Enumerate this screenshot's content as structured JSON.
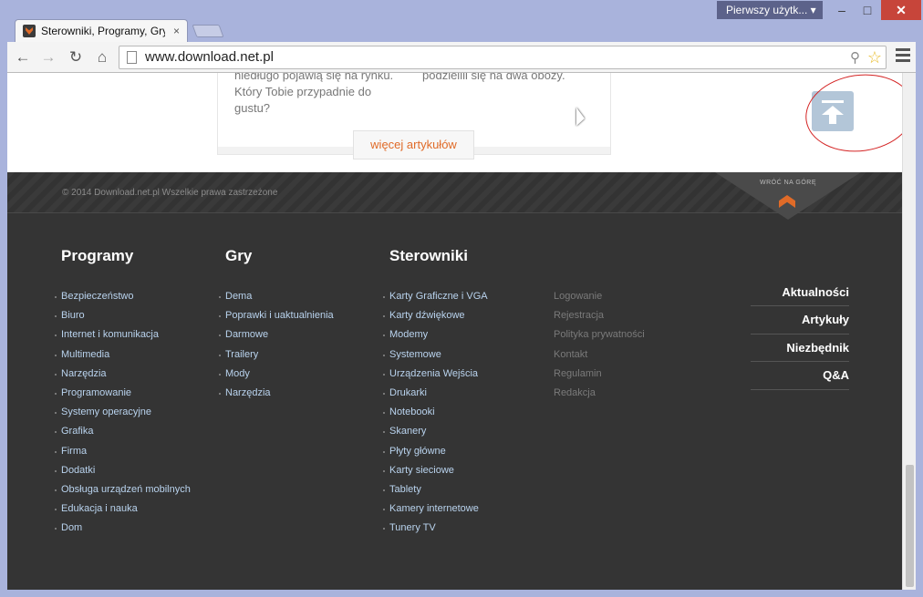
{
  "window": {
    "profile_label": "Pierwszy użytk... ▾",
    "minimize": "–",
    "maximize": "□",
    "close": "✕"
  },
  "tab": {
    "title": "Sterowniki, Programy, Gry",
    "close": "×"
  },
  "toolbar": {
    "url": "www.download.net.pl"
  },
  "article": {
    "left_text": "niedługo pojawią się na rynku. Który Tobie przypadnie do gustu?",
    "right_text": "podzielili się na dwa obozy.",
    "more_button": "więcej artykułów"
  },
  "footer": {
    "copyright": "© 2014 Download.net.pl Wszelkie prawa zastrzeżone",
    "back_to_top": "WRÓĆ NA GÓRĘ",
    "columns": [
      {
        "title": "Programy",
        "items": [
          "Bezpieczeństwo",
          "Biuro",
          "Internet i komunikacja",
          "Multimedia",
          "Narzędzia",
          "Programowanie",
          "Systemy operacyjne",
          "Grafika",
          "Firma",
          "Dodatki",
          "Obsługa urządzeń mobilnych",
          "Edukacja i nauka",
          "Dom"
        ]
      },
      {
        "title": "Gry",
        "items": [
          "Dema",
          "Poprawki i uaktualnienia",
          "Darmowe",
          "Trailery",
          "Mody",
          "Narzędzia"
        ]
      },
      {
        "title": "Sterowniki",
        "items": [
          "Karty Graficzne i VGA",
          "Karty dźwiękowe",
          "Modemy",
          "Systemowe",
          "Urządzenia Wejścia",
          "Drukarki",
          "Notebooki",
          "Skanery",
          "Płyty główne",
          "Karty sieciowe",
          "Tablety",
          "Kamery internetowe",
          "Tunery TV"
        ]
      }
    ],
    "misc_links": [
      "Logowanie",
      "Rejestracja",
      "Polityka prywatności",
      "Kontakt",
      "Regulamin",
      "Redakcja"
    ],
    "right_nav": [
      "Aktualności",
      "Artykuły",
      "Niezbędnik",
      "Q&A"
    ]
  },
  "icons": {
    "back": "back-arrow-icon",
    "forward": "forward-arrow-icon",
    "reload": "reload-icon",
    "home": "home-icon",
    "zoom": "zoom-icon",
    "bookmark": "star-icon",
    "menu": "hamburger-menu-icon",
    "scroll_top": "scroll-to-top-icon"
  },
  "colors": {
    "accent": "#e06b28",
    "footer_bg": "#343434",
    "link": "#b9d3ee"
  }
}
